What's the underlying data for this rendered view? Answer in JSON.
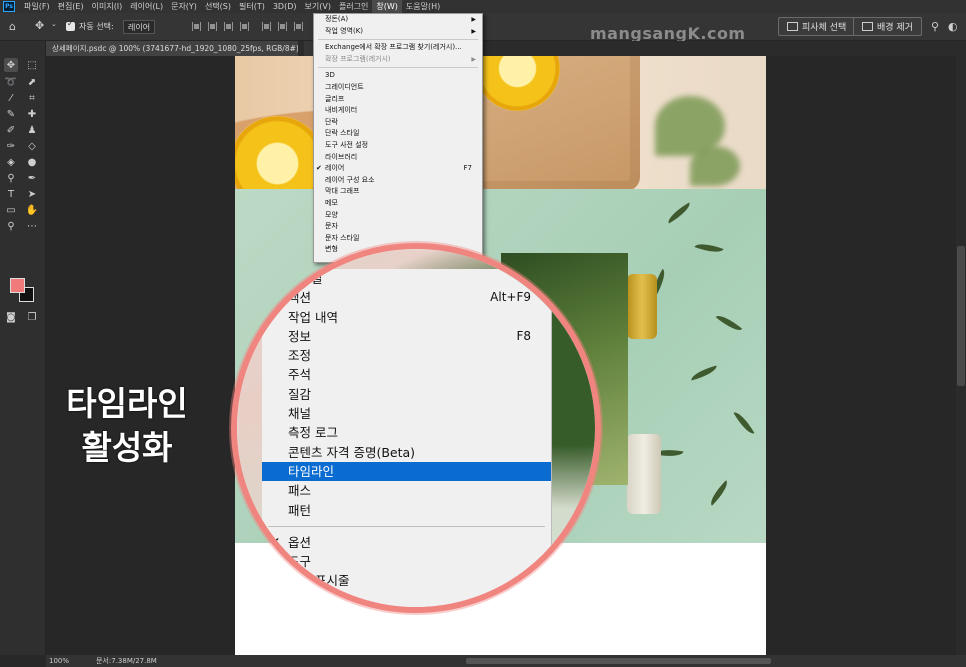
{
  "menubar": {
    "logo": "Ps",
    "items": [
      "파일(F)",
      "편집(E)",
      "이미지(I)",
      "레이어(L)",
      "문자(Y)",
      "선택(S)",
      "필터(T)",
      "3D(D)",
      "보기(V)",
      "플러그인",
      "창(W)",
      "도움말(H)"
    ],
    "active_index": 10
  },
  "optbar": {
    "auto_select_label": "자동 선택:",
    "auto_select_value": "레이어",
    "watermark": "mangsangK.com",
    "subject_select_label": "피사체 선택",
    "remove_bg_label": "배경 제거"
  },
  "tab": {
    "title": "상세페이지.psdc @ 100% (3741677-hd_1920_1080_25fps, RGB/8#) *",
    "close": "×"
  },
  "window_menu": {
    "items": [
      {
        "label": "정돈(A)",
        "submenu": true
      },
      {
        "label": "작업 영역(K)",
        "submenu": true
      },
      {
        "sep": true
      },
      {
        "label": "Exchange에서 확장 프로그램 찾기(레거시)..."
      },
      {
        "label": "확장 프로그램(레거시)",
        "submenu": true,
        "disabled": true
      },
      {
        "sep": true
      },
      {
        "label": "3D"
      },
      {
        "label": "그레이디언트"
      },
      {
        "label": "글리프"
      },
      {
        "label": "내비게이터"
      },
      {
        "label": "단락"
      },
      {
        "label": "단락 스타일"
      },
      {
        "label": "도구 사전 설정"
      },
      {
        "label": "라이브러리"
      },
      {
        "label": "레이어",
        "shortcut": "F7",
        "checked": true
      },
      {
        "label": "레이어 구성 요소"
      },
      {
        "label": "막대 그래프"
      },
      {
        "label": "메모"
      },
      {
        "label": "모양"
      },
      {
        "label": "문자"
      },
      {
        "label": "문자 스타일"
      },
      {
        "label": "변형"
      }
    ]
  },
  "magnified_menu": {
    "items": [
      {
        "label": "스타일"
      },
      {
        "label": "액션",
        "shortcut": "Alt+F9"
      },
      {
        "label": "작업 내역"
      },
      {
        "label": "정보",
        "shortcut": "F8"
      },
      {
        "label": "조정"
      },
      {
        "label": "주석"
      },
      {
        "label": "질감"
      },
      {
        "label": "채널"
      },
      {
        "label": "측정 로그"
      },
      {
        "label": "콘텐츠 자격 증명(Beta)"
      },
      {
        "label": "타임라인",
        "highlight": true
      },
      {
        "label": "패스"
      },
      {
        "label": "패턴"
      },
      {
        "sep": true
      },
      {
        "label": "옵션",
        "checked": true
      },
      {
        "label": "도구"
      },
      {
        "label": "작업 표시줄"
      }
    ]
  },
  "caption": {
    "line1": "타임라인",
    "line2": "활성화"
  },
  "status": {
    "zoom": "100%",
    "doc": "문서:7.38M/27.8M"
  },
  "colors": {
    "foreground": "#f07a7a",
    "background": "#111111",
    "highlight": "#0a6bd0",
    "magnifier_ring": "#f08580"
  }
}
